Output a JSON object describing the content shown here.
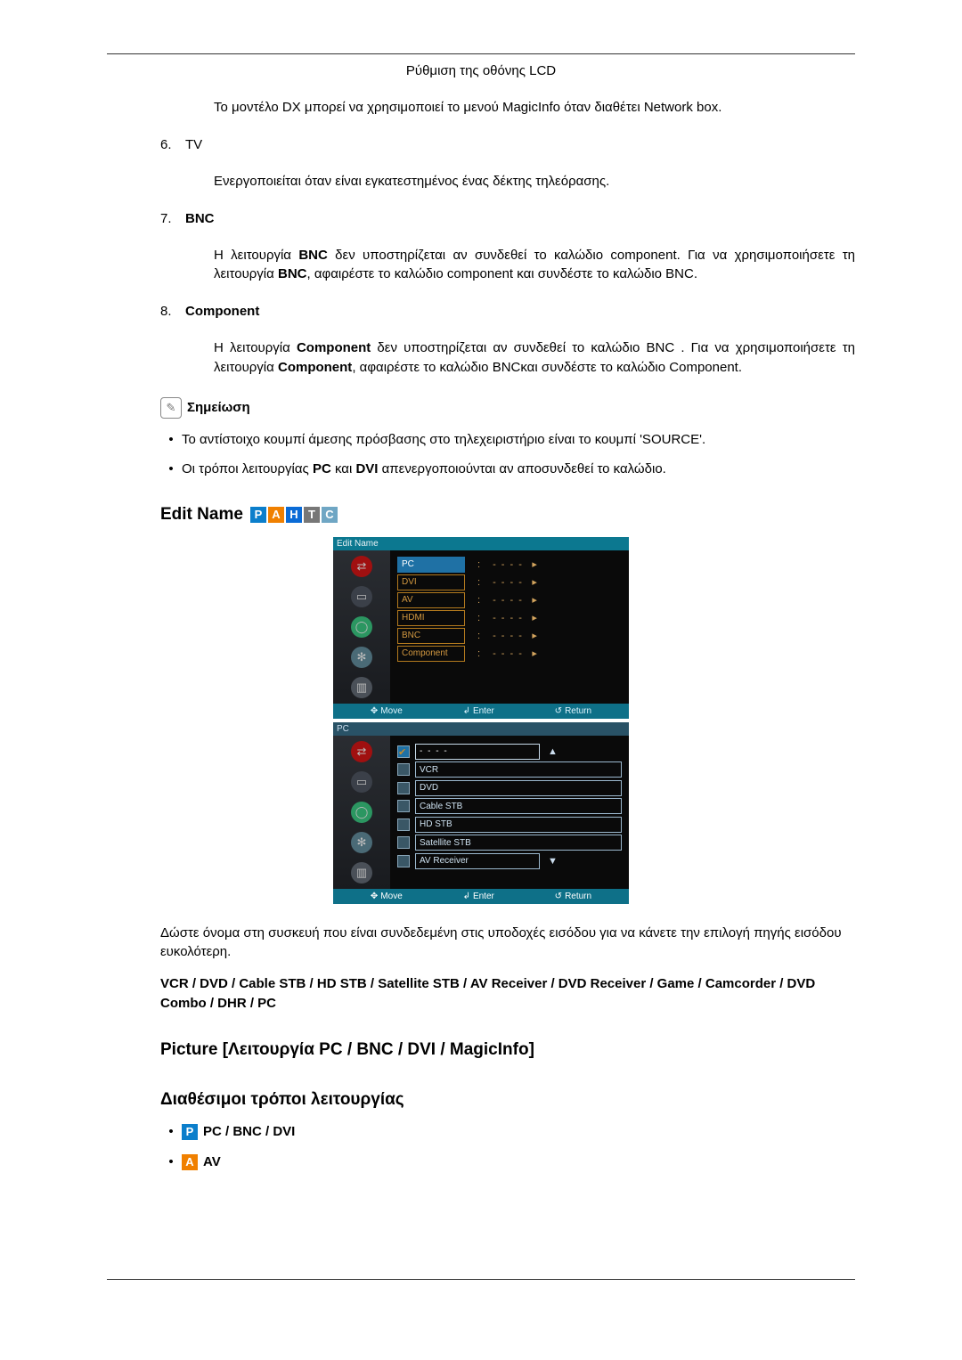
{
  "header": {
    "title": "Ρύθμιση της οθόνης LCD"
  },
  "intro": "Το μοντέλο DX μπορεί να χρησιμοποιεί το μενού MagicInfo όταν διαθέτει Network box.",
  "items": [
    {
      "num": "6.",
      "heading": "TV",
      "bold": false,
      "body": "Ενεργοποιείται όταν είναι εγκατεστημένος ένας δέκτης τηλεόρασης."
    },
    {
      "num": "7.",
      "heading": "BNC",
      "bold": true,
      "body_html": "Η λειτουργία <b>BNC</b> δεν υποστηρίζεται αν συνδεθεί το καλώδιο component. Για να χρησιμοποιήσετε τη λειτουργία <b>BNC</b>, αφαιρέστε το καλώδιο component και συνδέστε το καλώδιο BNC."
    },
    {
      "num": "8.",
      "heading": "Component",
      "bold": true,
      "body_html": "Η λειτουργία <b>Component</b> δεν υποστηρίζεται αν συνδεθεί το καλώδιο BNC . Για να χρησιμοποιήσετε τη λειτουργία <b>Component</b>, αφαιρέστε το καλώδιο BNCκαι συνδέστε το καλώδιο Component."
    }
  ],
  "note": {
    "title": "Σημείωση",
    "bullets": [
      "Το αντίστοιχο κουμπί άμεσης πρόσβασης στο τηλεχειριστήριο είναι το κουμπί 'SOURCE'.",
      "Οι τρόποι λειτουργίας <b>PC</b> και <b>DVI</b> απενεργοποιούνται αν αποσυνδεθεί το καλώδιο."
    ]
  },
  "edit_name": {
    "heading": "Edit Name",
    "chips": [
      "P",
      "A",
      "H",
      "T",
      "C"
    ]
  },
  "osd1": {
    "title": "Edit Name",
    "rows": [
      "PC",
      "DVI",
      "AV",
      "HDMI",
      "BNC",
      "Component"
    ],
    "foot": {
      "move": "Move",
      "enter": "Enter",
      "return": "Return"
    }
  },
  "osd2": {
    "subtitle": "PC",
    "rows": [
      "",
      "VCR",
      "DVD",
      "Cable STB",
      "HD STB",
      "Satellite STB",
      "AV Receiver"
    ],
    "foot": {
      "move": "Move",
      "enter": "Enter",
      "return": "Return"
    }
  },
  "after_osd": {
    "p1": "Δώστε όνομα στη συσκευή που είναι συνδεδεμένη στις υποδοχές εισόδου για να κάνετε την επιλογή πηγής εισόδου ευκολότερη.",
    "p2": "VCR / DVD / Cable STB / HD STB / Satellite STB / AV Receiver / DVD Receiver / Game / Camcorder / DVD Combo / DHR / PC"
  },
  "picture": {
    "heading": "Picture [Λειτουργία PC / BNC / DVI / MagicInfo]",
    "sub": "Διαθέσιμοι τρόποι λειτουργίας",
    "modes": [
      {
        "chip": "P",
        "class": "chip-p",
        "label": "PC / BNC / DVI"
      },
      {
        "chip": "A",
        "class": "chip-a",
        "label": "AV"
      }
    ]
  }
}
